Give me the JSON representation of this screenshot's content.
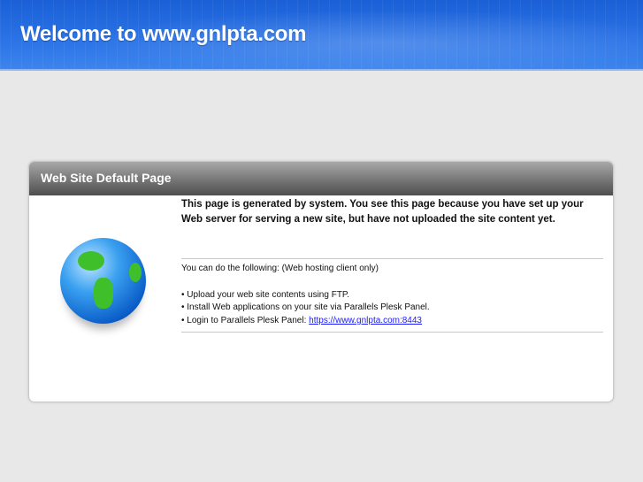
{
  "banner": {
    "title": "Welcome to www.gnlpta.com"
  },
  "panel": {
    "title": "Web Site Default Page",
    "intro": "This page is generated by system. You see this page because you have set up your Web server for serving a new site, but have not uploaded the site content yet.",
    "lead": "You can do the following: (Web hosting client only)",
    "items": [
      "• Upload your web site contents using FTP.",
      "• Install Web applications on your site via Parallels Plesk Panel.",
      "• Login to Parallels Plesk Panel: "
    ],
    "link": "https://www.gnlpta.com:8443"
  }
}
